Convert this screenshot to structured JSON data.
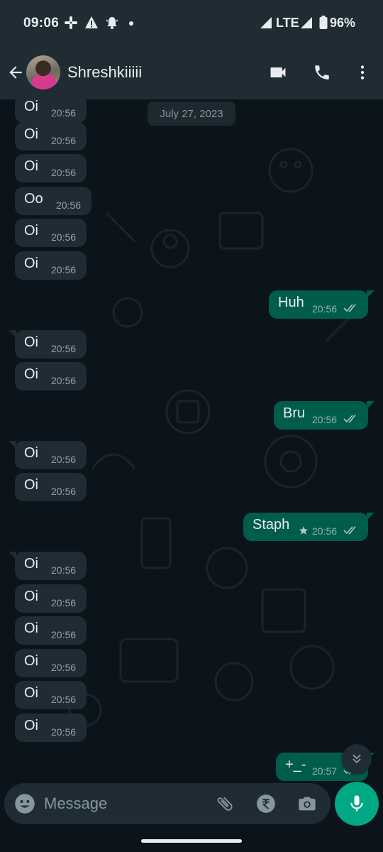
{
  "status_bar": {
    "time": "09:06",
    "network": "LTE",
    "battery": "96%",
    "icons": [
      "slack-icon",
      "alert-icon",
      "notification-bell-icon",
      "dot-icon",
      "signal-icon",
      "lte-signal-icon",
      "battery-icon"
    ]
  },
  "header": {
    "contact_name": "Shreshkiiiii",
    "icons": [
      "back-arrow-icon",
      "video-call-icon",
      "phone-icon",
      "more-vert-icon"
    ]
  },
  "chat": {
    "date_chip": "July 27, 2023",
    "messages": [
      {
        "dir": "in",
        "text": "Oi",
        "time": "20:56"
      },
      {
        "dir": "in",
        "text": "Oi",
        "time": "20:56"
      },
      {
        "dir": "in",
        "text": "Oi",
        "time": "20:56"
      },
      {
        "dir": "in",
        "text": "Oo",
        "time": "20:56"
      },
      {
        "dir": "in",
        "text": "Oi",
        "time": "20:56"
      },
      {
        "dir": "in",
        "text": "Oi",
        "time": "20:56"
      },
      {
        "dir": "out",
        "text": "Huh",
        "time": "20:56",
        "status": "read"
      },
      {
        "dir": "in",
        "text": "Oi",
        "time": "20:56"
      },
      {
        "dir": "in",
        "text": "Oi",
        "time": "20:56"
      },
      {
        "dir": "out",
        "text": "Bru",
        "time": "20:56",
        "status": "read"
      },
      {
        "dir": "in",
        "text": "Oi",
        "time": "20:56"
      },
      {
        "dir": "in",
        "text": "Oi",
        "time": "20:56"
      },
      {
        "dir": "out",
        "text": "Staph",
        "time": "20:56",
        "status": "read",
        "starred": true
      },
      {
        "dir": "in",
        "text": "Oi",
        "time": "20:56"
      },
      {
        "dir": "in",
        "text": "Oi",
        "time": "20:56"
      },
      {
        "dir": "in",
        "text": "Oi",
        "time": "20:56"
      },
      {
        "dir": "in",
        "text": "Oi",
        "time": "20:56"
      },
      {
        "dir": "in",
        "text": "Oi",
        "time": "20:56"
      },
      {
        "dir": "in",
        "text": "Oi",
        "time": "20:56"
      },
      {
        "dir": "out",
        "text": "+_-",
        "time": "20:57",
        "status": "read"
      }
    ]
  },
  "input": {
    "placeholder": "Message",
    "icons": [
      "emoji-icon",
      "attach-icon",
      "rupee-payment-icon",
      "camera-icon",
      "mic-icon"
    ]
  },
  "colors": {
    "header_bg": "#1f2c34",
    "chat_bg": "#0b141a",
    "incoming_bubble": "#1f2c34",
    "outgoing_bubble": "#005c4b",
    "accent": "#00a884"
  }
}
